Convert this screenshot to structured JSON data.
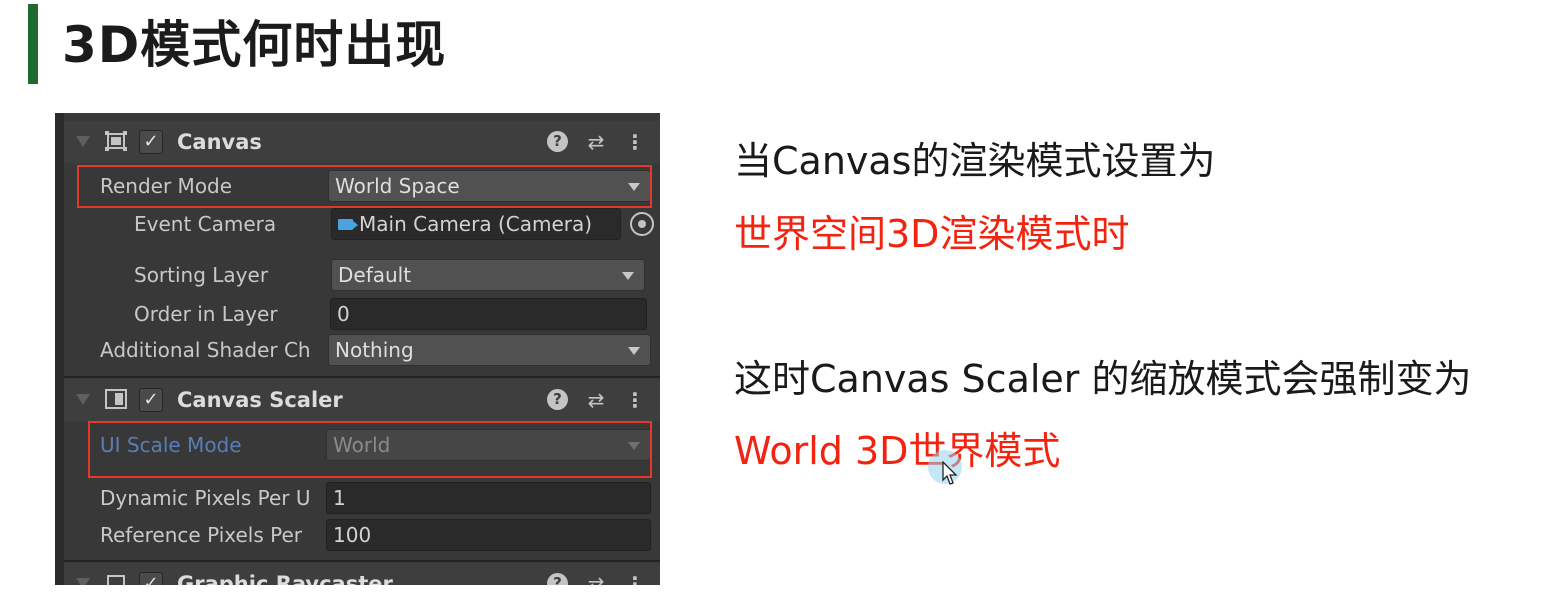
{
  "slide": {
    "title": "3D模式何时出现",
    "accent_color": "#1f6a31"
  },
  "inspector": {
    "canvas": {
      "name": "Canvas",
      "enabled": true,
      "icon": "canvas-rect-icon",
      "render_mode": {
        "label": "Render Mode",
        "value": "World Space"
      },
      "event_camera": {
        "label": "Event Camera",
        "value": "Main Camera (Camera)",
        "icon": "camera-icon"
      },
      "sorting_layer": {
        "label": "Sorting Layer",
        "value": "Default"
      },
      "order_in_layer": {
        "label": "Order in Layer",
        "value": "0"
      },
      "additional_shader": {
        "label": "Additional Shader Ch",
        "value": "Nothing"
      }
    },
    "canvas_scaler": {
      "name": "Canvas Scaler",
      "enabled": true,
      "icon": "canvas-scaler-icon",
      "ui_scale_mode": {
        "label": "UI Scale Mode",
        "value": "World"
      },
      "dynamic_pixels": {
        "label": "Dynamic Pixels Per U",
        "value": "1"
      },
      "reference_pixels": {
        "label": "Reference Pixels Per",
        "value": "100"
      }
    },
    "graphic_raycaster": {
      "name": "Graphic Raycaster",
      "icon": "raycaster-icon"
    },
    "header_icons": [
      "help-icon",
      "presets-icon",
      "more-icon"
    ],
    "checkbox_glyph": "✓",
    "highlight_color": "#e3392b"
  },
  "explanation": {
    "line1": "当Canvas的渲染模式设置为",
    "line2": "世界空间3D渲染模式时",
    "line3": "这时Canvas Scaler 的缩放模式会强制变为",
    "line4": "World 3D世界模式",
    "highlight_color": "#f2230f"
  }
}
